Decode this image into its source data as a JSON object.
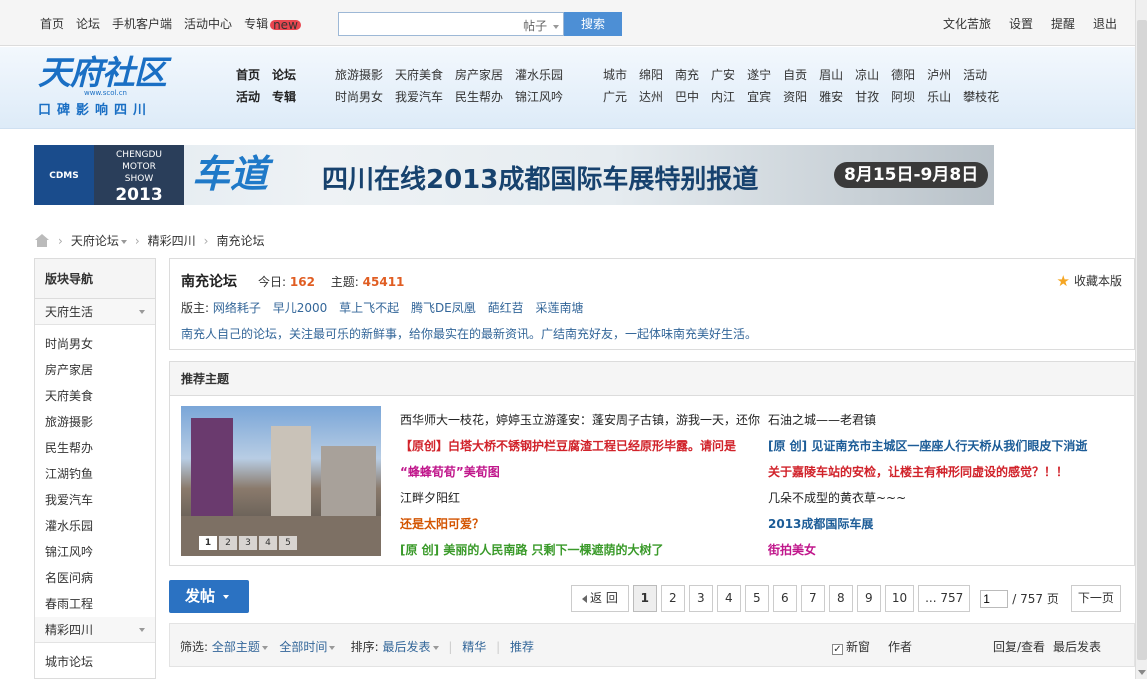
{
  "topbar": {
    "links": [
      "首页",
      "论坛",
      "手机客户端",
      "活动中心",
      "专辑"
    ],
    "new_badge": "new",
    "search_type": "帖子",
    "search_button": "搜索",
    "right_links": [
      "文化苦旅",
      "设置",
      "提醒",
      "退出"
    ]
  },
  "header": {
    "logo_title": "天府社区",
    "logo_url": "www.scol.cn",
    "logo_slogan": "口碑影响四川",
    "main_nav": [
      [
        "首页",
        "论坛"
      ],
      [
        "活动",
        "专辑"
      ]
    ],
    "topic_nav": [
      [
        "旅游摄影",
        "天府美食",
        "房产家居",
        "灌水乐园"
      ],
      [
        "时尚男女",
        "我爱汽车",
        "民生帮办",
        "锦江风吟"
      ]
    ],
    "city_nav": [
      [
        "城市",
        "绵阳",
        "南充",
        "广安",
        "遂宁",
        "自贡",
        "眉山",
        "凉山",
        "德阳",
        "泸州",
        "活动"
      ],
      [
        "广元",
        "达州",
        "巴中",
        "内江",
        "宜宾",
        "资阳",
        "雅安",
        "甘孜",
        "阿坝",
        "乐山",
        "攀枝花"
      ]
    ]
  },
  "banner": {
    "cdms": "CDMS",
    "motor_show": [
      "CHENGDU",
      "MOTOR",
      "SHOW",
      "2013"
    ],
    "chedao": "车道",
    "title": "四川在线2013成都国际车展特别报道",
    "date": "8月15日-9月8日"
  },
  "breadcrumb": [
    "天府论坛",
    "精彩四川",
    "南充论坛"
  ],
  "sidebar": {
    "header": "版块导航",
    "group1": "天府生活",
    "items": [
      "时尚男女",
      "房产家居",
      "天府美食",
      "旅游摄影",
      "民生帮办",
      "江湖钓鱼",
      "我爱汽车",
      "灌水乐园",
      "锦江风吟",
      "名医问病",
      "春雨工程"
    ],
    "group2": "精彩四川",
    "items2": [
      "城市论坛"
    ]
  },
  "forum": {
    "name": "南充论坛",
    "today_label": "今日:",
    "today": "162",
    "topics_label": "主题:",
    "topics": "45411",
    "fav": "收藏本版",
    "mods_label": "版主:",
    "mods": [
      "网络耗子",
      "早儿2000",
      "草上飞不起",
      "腾飞DE凤凰",
      "葩红苕",
      "采莲南塘"
    ],
    "description": "南充人自己的论坛，关注最可乐的新鲜事，给你最实在的最新资讯。广结南充好友，一起体味南充美好生活。"
  },
  "recommend": {
    "header": "推荐主题",
    "slide_nums": [
      "1",
      "2",
      "3",
      "4",
      "5"
    ],
    "rows": [
      [
        {
          "text": "西华师大一枝花，婷婷玉立游蓬安：蓬安周子古镇，游我一天，还你",
          "color": "black"
        },
        {
          "text": "石油之城——老君镇",
          "color": "black"
        }
      ],
      [
        {
          "text": "【原创】白塔大桥不锈钢护栏豆腐渣工程已经原形毕露。请问是",
          "color": "red"
        },
        {
          "text": "[原 创] 见证南充市主城区一座座人行天桥从我们眼皮下消逝",
          "color": "blue"
        }
      ],
      [
        {
          "text": "“蜂蜂荀荀”美荀图",
          "color": "pink"
        },
        {
          "text": "关于嘉陵车站的安检，让楼主有种形同虚设的感觉？！！",
          "color": "red"
        }
      ],
      [
        {
          "text": "江畔夕阳红",
          "color": "black"
        },
        {
          "text": "几朵不成型的黄衣草~~~",
          "color": "black"
        }
      ],
      [
        {
          "text": "还是太阳可爱？",
          "color": "orange"
        },
        {
          "text": "2013成都国际车展",
          "color": "blue"
        }
      ],
      [
        {
          "text": "[原 创] 美丽的人民南路  只剩下一棵遮荫的大树了",
          "color": "green"
        },
        {
          "text": "街拍美女",
          "color": "pink"
        }
      ]
    ]
  },
  "toolbar": {
    "post_button": "发帖",
    "back": "返 回",
    "pages": [
      "1",
      "2",
      "3",
      "4",
      "5",
      "6",
      "7",
      "8",
      "9",
      "10"
    ],
    "last_page": "... 757",
    "jump_value": "1",
    "total": "/ 757 页",
    "next": "下一页"
  },
  "filter": {
    "label": "筛选:",
    "all_topics": "全部主题",
    "all_time": "全部时间",
    "sort_label": "排序:",
    "latest": "最后发表",
    "digest": "精华",
    "recommend": "推荐",
    "new_window": "新窗",
    "author": "作者",
    "replies": "回复/查看",
    "last_post": "最后发表"
  }
}
